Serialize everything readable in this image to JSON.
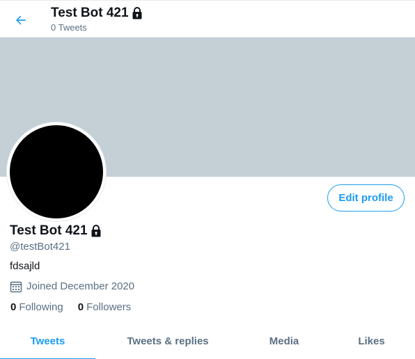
{
  "header": {
    "back_icon": "arrow-left-icon",
    "title": "Test Bot 421",
    "lock_icon": "lock-icon",
    "subtitle": "0 Tweets"
  },
  "profile": {
    "banner_color": "#c4cfd6",
    "avatar_color": "#000000",
    "edit_button": "Edit profile",
    "name": "Test Bot 421",
    "handle": "@testBot421",
    "bio": "fdsajld",
    "joined_icon": "calendar-icon",
    "joined": "Joined December 2020",
    "following_count": "0",
    "following_label": "Following",
    "followers_count": "0",
    "followers_label": "Followers"
  },
  "tabs": [
    {
      "label": "Tweets",
      "active": true
    },
    {
      "label": "Tweets & replies",
      "active": false
    },
    {
      "label": "Media",
      "active": false
    },
    {
      "label": "Likes",
      "active": false
    }
  ],
  "colors": {
    "accent": "#1d9bf0",
    "text_primary": "#0f1419",
    "text_secondary": "#5b7083"
  }
}
